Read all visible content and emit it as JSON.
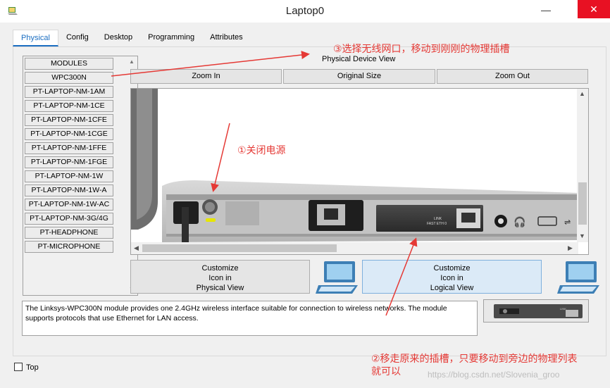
{
  "window": {
    "title": "Laptop0",
    "minimize_glyph": "—",
    "maximize_glyph": "☐",
    "close_glyph": "✕"
  },
  "tabs": [
    {
      "label": "Physical",
      "active": true
    },
    {
      "label": "Config",
      "active": false
    },
    {
      "label": "Desktop",
      "active": false
    },
    {
      "label": "Programming",
      "active": false
    },
    {
      "label": "Attributes",
      "active": false
    }
  ],
  "modules": {
    "items": [
      "MODULES",
      "WPC300N",
      "PT-LAPTOP-NM-1AM",
      "PT-LAPTOP-NM-1CE",
      "PT-LAPTOP-NM-1CFE",
      "PT-LAPTOP-NM-1CGE",
      "PT-LAPTOP-NM-1FFE",
      "PT-LAPTOP-NM-1FGE",
      "PT-LAPTOP-NM-1W",
      "PT-LAPTOP-NM-1W-A",
      "PT-LAPTOP-NM-1W-AC",
      "PT-LAPTOP-NM-3G/4G",
      "PT-HEADPHONE",
      "PT-MICROPHONE"
    ]
  },
  "device_view": {
    "label": "Physical Device View",
    "zoom_in": "Zoom In",
    "original_size": "Original Size",
    "zoom_out": "Zoom Out",
    "slot_link_label": "LINK",
    "slot_port_label": "FAST ETH 0"
  },
  "customize": {
    "physical": [
      "Customize",
      "Icon in",
      "Physical View"
    ],
    "logical": [
      "Customize",
      "Icon in",
      "Logical View"
    ]
  },
  "description": "The Linksys-WPC300N module provides one 2.4GHz wireless interface suitable for connection to wireless networks. The module supports protocols that use Ethernet for LAN access.",
  "preview_label": "LINK",
  "bottom": {
    "top_label": "Top",
    "top_checked": false
  },
  "annotations": {
    "step1": "①关闭电源",
    "step2_line1": "②移走原来的插槽，只要移动到旁边的物理列表",
    "step2_line2": "就可以",
    "step3": "③选择无线网口，移动到刚刚的物理插槽"
  },
  "watermark": "https://blog.csdn.net/Slovenia_groo",
  "colors": {
    "accent": "#1c6fc2",
    "annotation": "#e53935",
    "close_button": "#e81123"
  }
}
